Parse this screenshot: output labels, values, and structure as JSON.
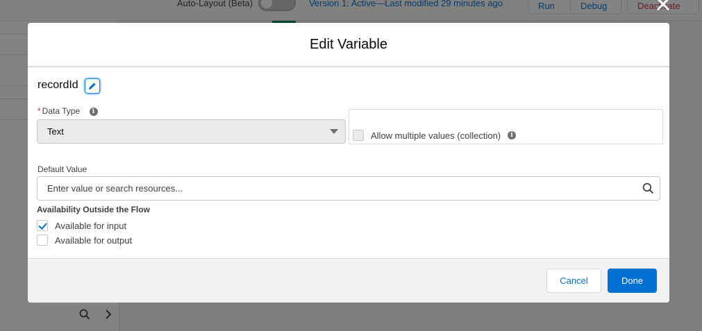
{
  "background": {
    "toggle_label": "Auto-Layout (Beta)",
    "version_text": "Version 1: Active—Last modified 29 minutes ago",
    "run_label": "Run",
    "debug_label": "Debug",
    "deactivate_label": "Deactivate"
  },
  "modal": {
    "title": "Edit Variable",
    "api_name": "recordId",
    "data_type": {
      "label": "Data Type",
      "required_marker": "*",
      "selected": "Text"
    },
    "collection": {
      "label": "Allow multiple values (collection)",
      "checked": false
    },
    "default_value": {
      "label": "Default Value",
      "placeholder": "Enter value or search resources..."
    },
    "availability": {
      "title": "Availability Outside the Flow",
      "input_label": "Available for input",
      "input_checked": true,
      "output_label": "Available for output",
      "output_checked": false
    },
    "footer": {
      "cancel_label": "Cancel",
      "done_label": "Done"
    }
  },
  "colors": {
    "brand": "#0070d2",
    "required": "#c23934"
  },
  "icons": {
    "close": "close-icon",
    "edit": "pencil-icon",
    "info": "info-icon",
    "search": "search-icon"
  }
}
